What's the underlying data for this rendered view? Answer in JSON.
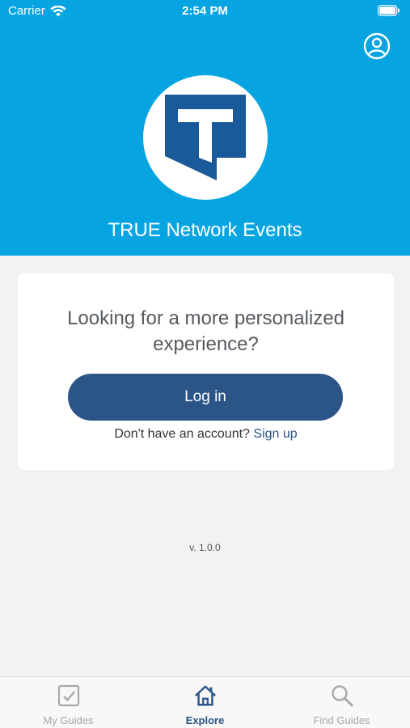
{
  "status_bar": {
    "carrier": "Carrier",
    "time": "2:54 PM"
  },
  "header": {
    "app_title": "TRUE Network Events",
    "logo_letter": "T"
  },
  "login_card": {
    "prompt": "Looking for a more personalized experience?",
    "login_label": "Log in",
    "no_account_text": "Don't have an account?",
    "signup_label": "Sign up"
  },
  "version": "v. 1.0.0",
  "tabbar": {
    "tabs": [
      {
        "label": "My Guides",
        "icon": "checklist-icon",
        "active": false
      },
      {
        "label": "Explore",
        "icon": "home-icon",
        "active": true
      },
      {
        "label": "Find Guides",
        "icon": "search-icon",
        "active": false
      }
    ]
  },
  "colors": {
    "header_bg": "#06a4e0",
    "primary": "#2c5587",
    "logo_blue": "#1a5a9a",
    "background": "#f2f2f2",
    "tab_inactive": "#a8a8a8"
  }
}
